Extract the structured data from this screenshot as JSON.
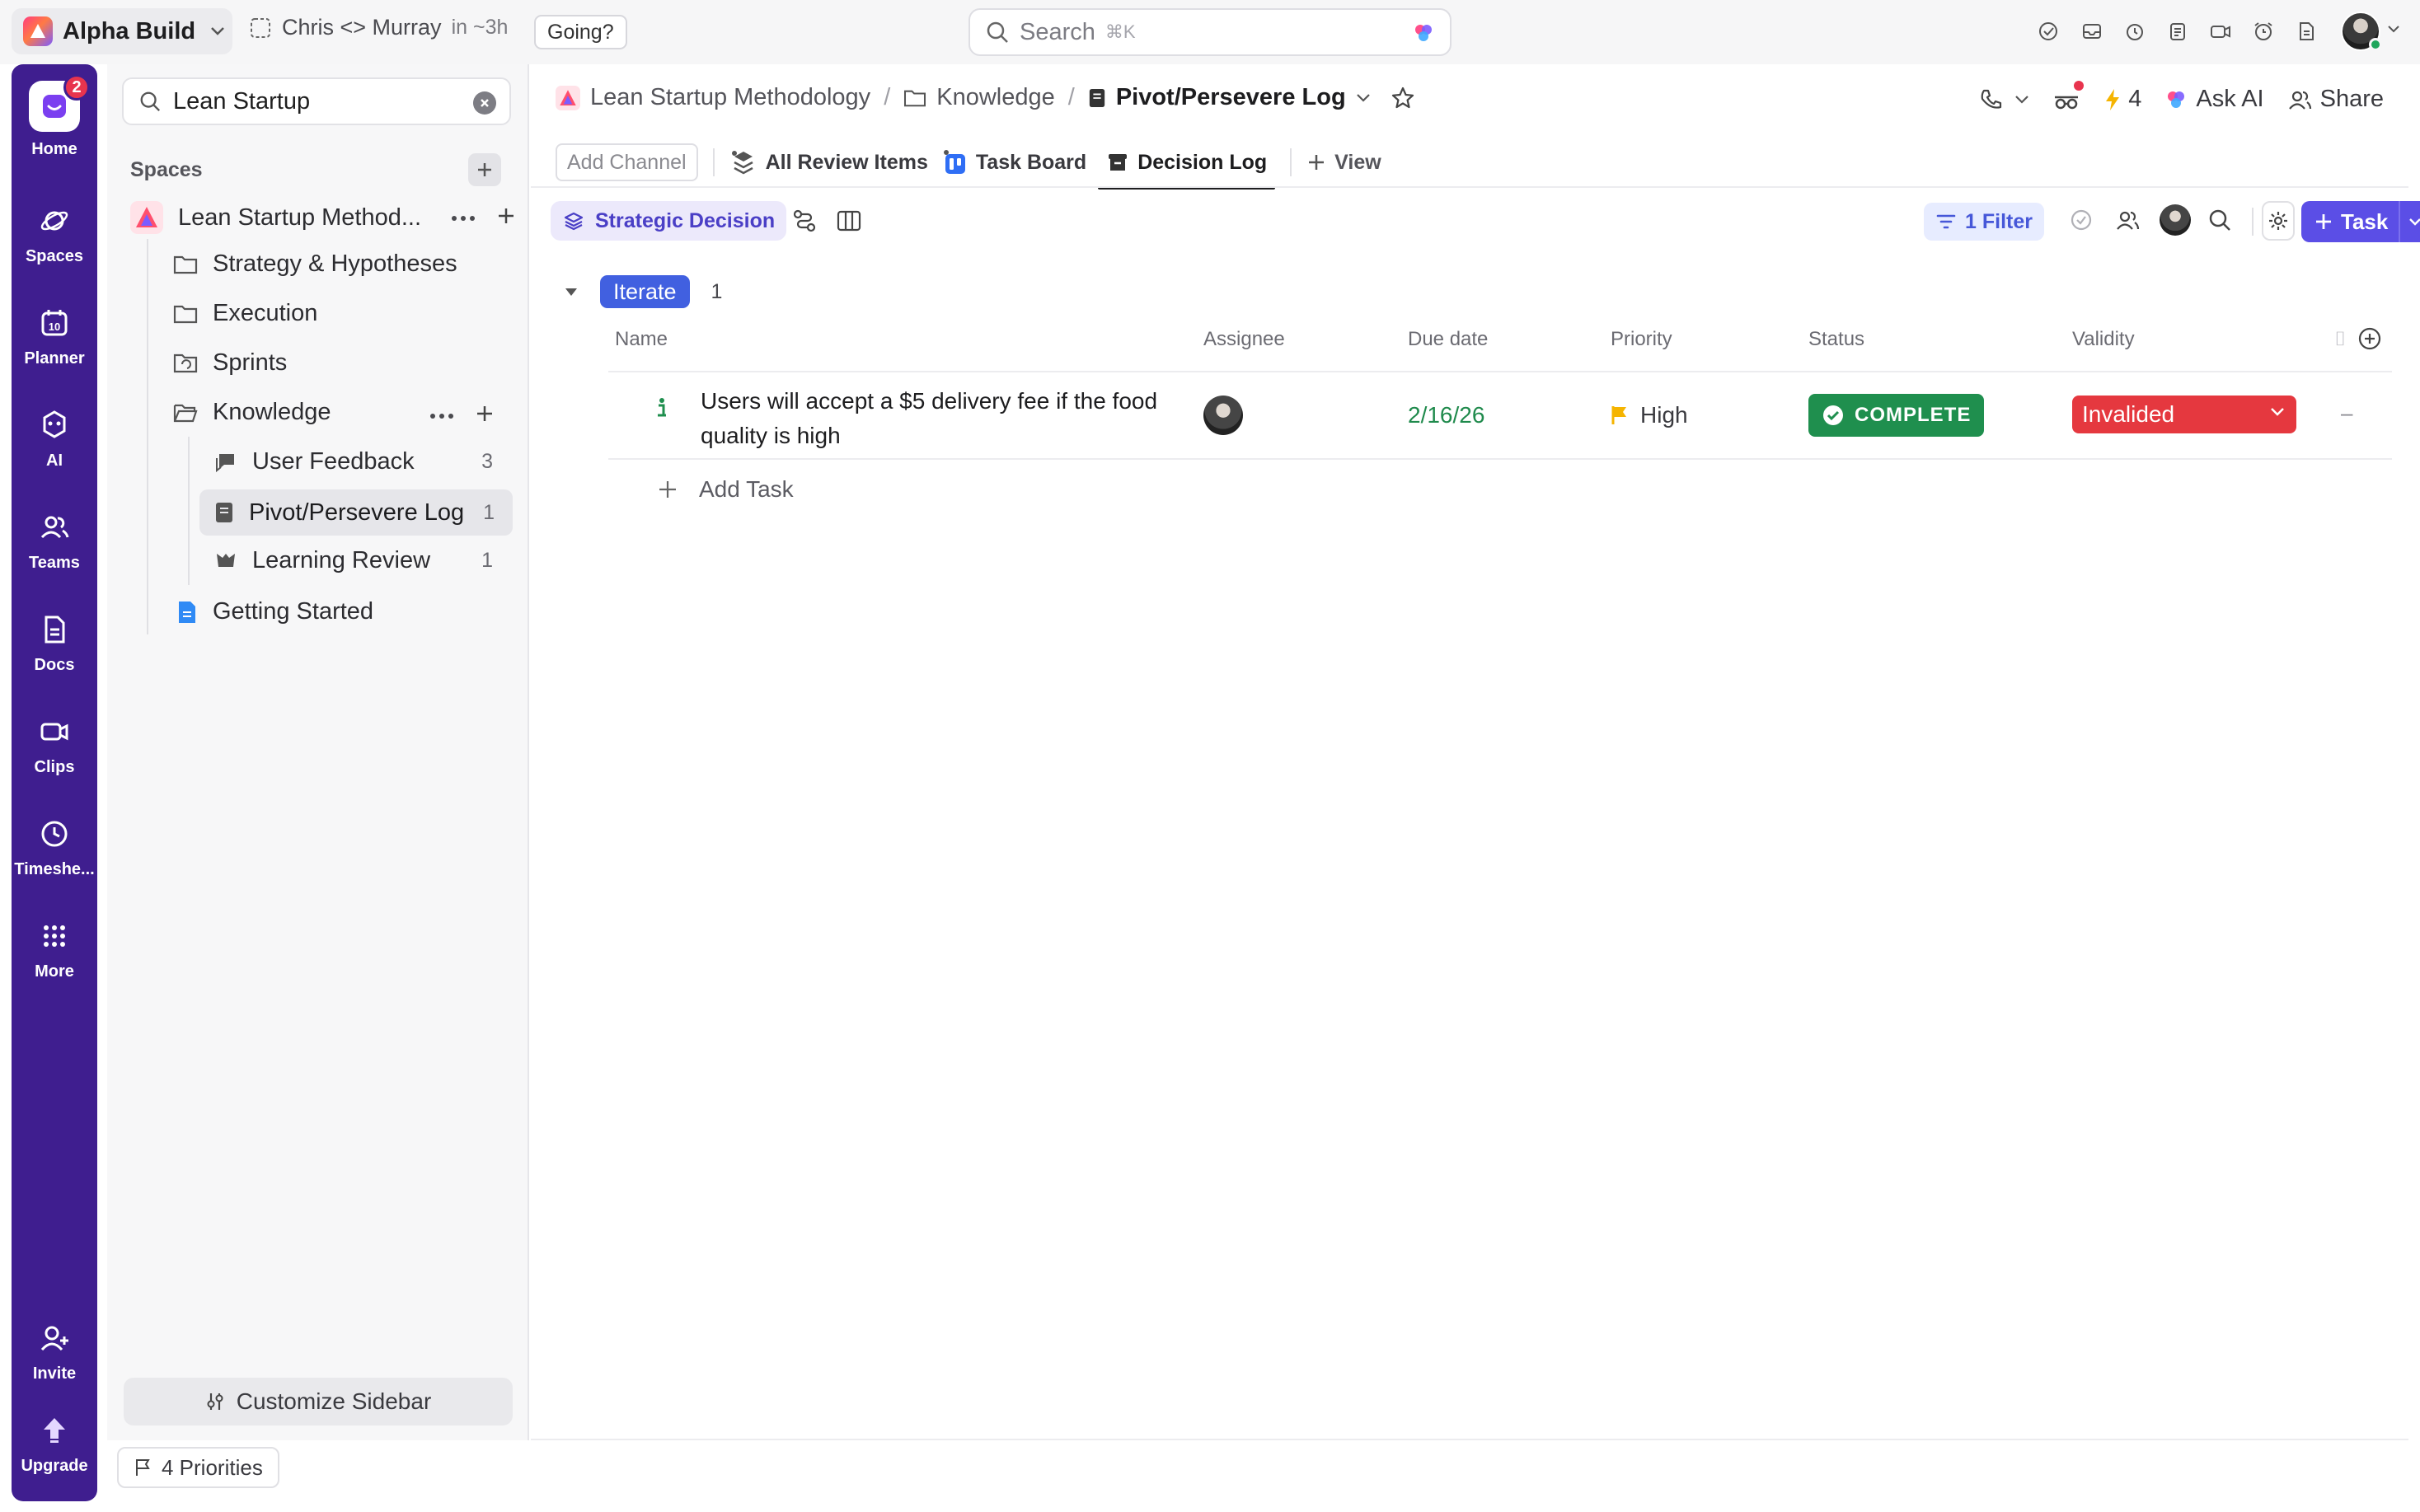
{
  "topbar": {
    "workspace_name": "Alpha Build",
    "meeting_title": "Chris <> Murray",
    "meeting_time": "in ~3h",
    "going_label": "Going?",
    "search_placeholder": "Search",
    "search_shortcut": "⌘K"
  },
  "rail": {
    "home_badge": "2",
    "items": [
      {
        "label": "Home"
      },
      {
        "label": "Spaces"
      },
      {
        "label": "Planner"
      },
      {
        "label": "AI"
      },
      {
        "label": "Teams"
      },
      {
        "label": "Docs"
      },
      {
        "label": "Clips"
      },
      {
        "label": "Timeshe..."
      },
      {
        "label": "More"
      }
    ],
    "invite_label": "Invite",
    "upgrade_label": "Upgrade",
    "planner_day": "10"
  },
  "sidebar": {
    "search_value": "Lean Startup",
    "spaces_header": "Spaces",
    "space_name": "Lean Startup Method...",
    "folders": [
      {
        "label": "Strategy & Hypotheses"
      },
      {
        "label": "Execution"
      },
      {
        "label": "Sprints"
      },
      {
        "label": "Knowledge"
      }
    ],
    "lists": [
      {
        "label": "User Feedback",
        "count": "3"
      },
      {
        "label": "Pivot/Persevere Log",
        "count": "1"
      },
      {
        "label": "Learning Review",
        "count": "1"
      }
    ],
    "doc_label": "Getting Started",
    "customize_label": "Customize Sidebar",
    "priorities_label": "4 Priorities"
  },
  "header": {
    "breadcrumb_space": "Lean Startup Methodology",
    "breadcrumb_folder": "Knowledge",
    "breadcrumb_list": "Pivot/Persevere Log",
    "automation_count": "4",
    "ask_ai_label": "Ask AI",
    "share_label": "Share"
  },
  "tabs": {
    "add_channel": "Add Channel",
    "items": [
      {
        "label": "All Review Items"
      },
      {
        "label": "Task Board"
      },
      {
        "label": "Decision Log"
      }
    ],
    "view_label": "View"
  },
  "toolbar": {
    "chip_label": "Strategic Decision",
    "filter_label": "1 Filter",
    "task_label": "Task"
  },
  "group": {
    "name": "Iterate",
    "count": "1"
  },
  "columns": {
    "name": "Name",
    "assignee": "Assignee",
    "due_date": "Due date",
    "priority": "Priority",
    "status": "Status",
    "validity": "Validity"
  },
  "rows": [
    {
      "title": "Users will accept a $5 delivery fee if the food quality is high",
      "due_date": "2/16/26",
      "priority": "High",
      "status": "COMPLETE",
      "validity": "Invalided",
      "extra": "–"
    }
  ],
  "add_task_label": "Add Task",
  "colors": {
    "rail_bg": "#3f1e8f",
    "accent": "#5b4ee6",
    "group_pill": "#4160e0",
    "status_complete": "#1f8f4e",
    "validity_invalided": "#e5383f",
    "priority_high": "#f5b400",
    "due_green": "#1f8a4c"
  }
}
